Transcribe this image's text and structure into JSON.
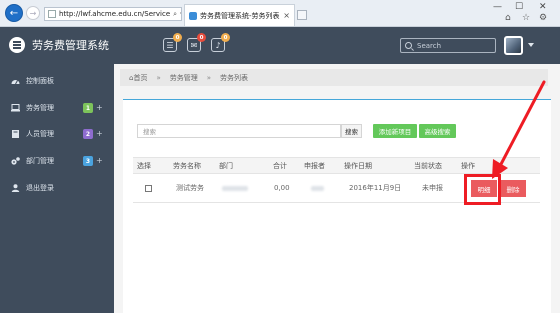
{
  "browser": {
    "url": "http://lwf.ahcme.edu.cn/Service",
    "tab_title": "劳务费管理系统-劳务列表",
    "addr_search_icon": "⌕",
    "addr_dropdown_icon": "▾",
    "addr_refresh_icon": "↻",
    "tab_close_icon": "×",
    "min_icon": "—",
    "max_icon": "☐",
    "close_icon": "✕",
    "home_icon": "⌂",
    "fav_icon": "☆",
    "settings_icon": "⚙"
  },
  "header": {
    "title": "劳务费管理系统",
    "search_placeholder": "Search",
    "icons": [
      {
        "name": "list-icon",
        "glyph": "☰",
        "badge": "0",
        "badge_color": "#f0ad4e"
      },
      {
        "name": "envelope-icon",
        "glyph": "✉",
        "badge": "0",
        "badge_color": "#e74c3c"
      },
      {
        "name": "bell-icon",
        "glyph": "♪",
        "badge": "0",
        "badge_color": "#f0ad4e"
      }
    ]
  },
  "sidebar": {
    "items": [
      {
        "label": "控制面板",
        "icon": "dashboard-icon"
      },
      {
        "label": "劳务管理",
        "icon": "laptop-icon",
        "badge": "1",
        "badge_color": "#7dc35b",
        "plus": "+"
      },
      {
        "label": "人员管理",
        "icon": "book-icon",
        "badge": "2",
        "badge_color": "#8e6ccf",
        "plus": "+"
      },
      {
        "label": "部门管理",
        "icon": "cogs-icon",
        "badge": "3",
        "badge_color": "#4aa3df",
        "plus": "+"
      },
      {
        "label": "退出登录",
        "icon": "user-icon"
      }
    ]
  },
  "breadcrumb": {
    "home_icon": "⌂",
    "items": [
      "首页",
      "劳务管理",
      "劳务列表"
    ],
    "separator": "»"
  },
  "toolbar": {
    "search_placeholder": "搜索",
    "search_button": "搜索",
    "add_button": "添加新项目",
    "advanced_button": "高级搜索"
  },
  "table": {
    "headers": [
      "选择",
      "劳务名称",
      "部门",
      "合计",
      "申报者",
      "操作日期",
      "当前状态",
      "操作"
    ],
    "rows": [
      {
        "name": "测试劳务",
        "total": "0,00",
        "date": "2016年11月9日",
        "status": "未申报",
        "detail": "明细",
        "delete": "删除"
      }
    ]
  },
  "colors": {
    "header_bg": "#3f4c5c",
    "accent_blue": "#45a7d9",
    "green": "#63c85a",
    "red_button": "#ea5b5e",
    "highlight_red": "#ee1c24"
  }
}
